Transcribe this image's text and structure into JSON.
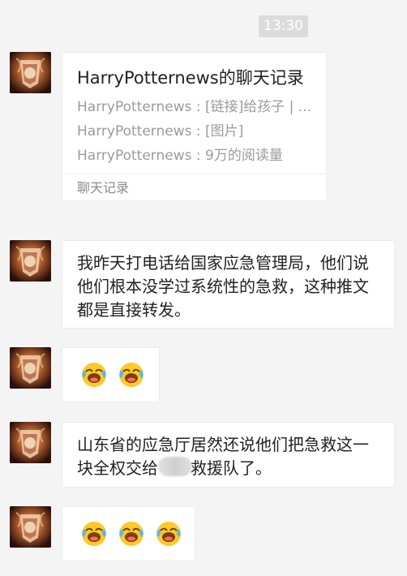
{
  "timestamp": "13:30",
  "colors": {
    "background": "#f4f4f4",
    "bubble": "#ffffff",
    "badge": "#dcdcdc"
  },
  "record": {
    "title": "HarryPotternews的聊天记录",
    "lines": [
      "HarryPotternews : [链接]给孩子 | ...",
      "HarryPotternews : [图片]",
      "HarryPotternews : 9万的阅读量"
    ],
    "footer": "聊天记录"
  },
  "messages": [
    {
      "lines": [
        "我昨天打电话给国家应急管理局，他们说",
        "他们根本没学过系统性的急救，这种推文",
        "都是直接转发。"
      ]
    },
    {
      "emojis": [
        "face-with-tears-icon",
        "face-with-tears-icon"
      ]
    },
    {
      "lines": [
        "山东省的应急厅居然还说他们把急救这一",
        "块全权交给",
        "救援队了。"
      ]
    },
    {
      "emojis": [
        "face-with-tears-icon",
        "face-with-tears-icon",
        "face-with-tears-icon"
      ]
    }
  ]
}
